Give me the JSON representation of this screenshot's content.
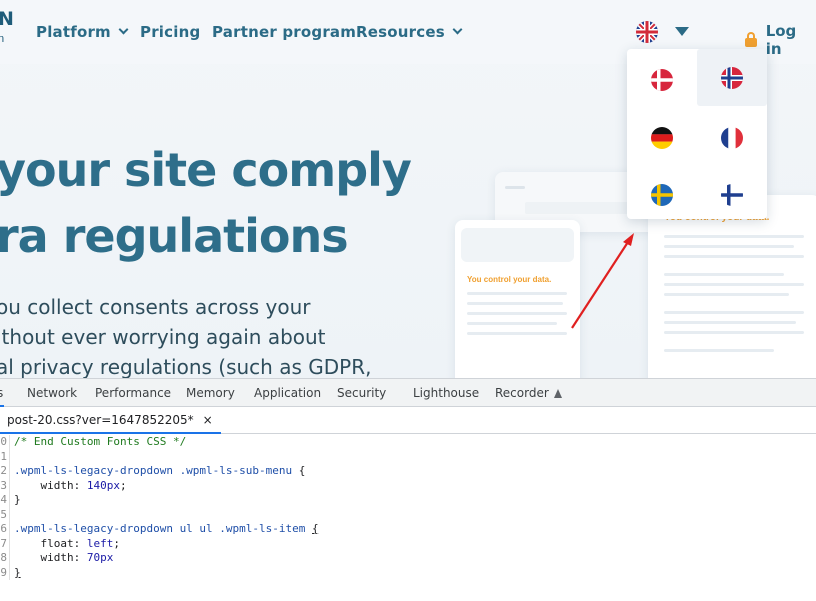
{
  "site": {
    "logo_fragment": "N",
    "logo_sub": "n",
    "nav": {
      "platform": "Platform",
      "pricing": "Pricing",
      "partner": "Partner program",
      "resources": "Resources"
    },
    "login": "Log in",
    "hero_line1": "your site comply",
    "hero_line2": "ra regulations",
    "body_line1": "ou collect consents across your",
    "body_line2": "ithout ever worrying again about",
    "body_line3": "al privacy regulations (such as GDPR,",
    "mock_text_small": "You control your data.",
    "mock_text_large": "You control your data.",
    "language_menu": {
      "current": "English",
      "options": [
        "Danish",
        "Norwegian",
        "German",
        "French",
        "Swedish",
        "Finnish"
      ],
      "hovered": "Norwegian"
    }
  },
  "devtools": {
    "tabs": [
      "s",
      "Network",
      "Performance",
      "Memory",
      "Application",
      "Security",
      "Lighthouse",
      "Recorder"
    ],
    "file_tab": "post-20.css?ver=1647852205*",
    "file_close": "×",
    "code": {
      "line_numbers": [
        "0",
        "1",
        "2",
        "3",
        "4",
        "5",
        "6",
        "7",
        "8",
        "9"
      ],
      "l0_comment": "/* End Custom Fonts CSS */",
      "l2_selector": ".wpml-ls-legacy-dropdown .wpml-ls-sub-menu",
      "l2_brace": "{",
      "l3_prop": "width:",
      "l3_value": "140px",
      "l3_end": ";",
      "l4_close": "}",
      "l6_selector": ".wpml-ls-legacy-dropdown ul ul .wpml-ls-item",
      "l6_brace": "{",
      "l7_prop": "float:",
      "l7_value": "left",
      "l7_end": ";",
      "l8_prop": "width:",
      "l8_value": "70px",
      "l9_close": "}"
    }
  },
  "colors": {
    "brand_teal": "#2e6e8a",
    "accent_orange": "#f0a030",
    "annotation_red": "#e02020",
    "devtools_active": "#1a73e8"
  }
}
